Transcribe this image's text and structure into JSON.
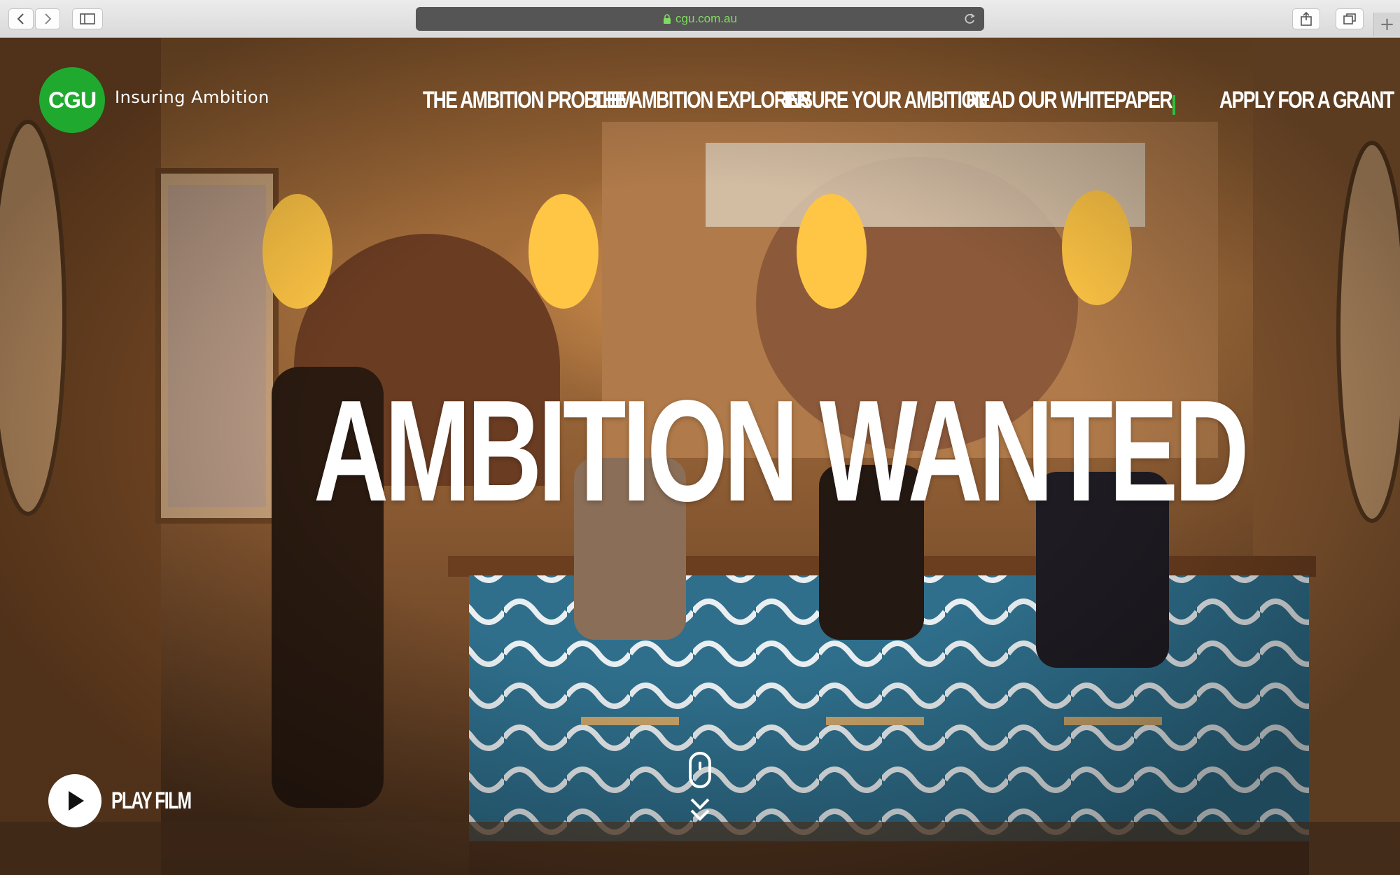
{
  "browser": {
    "url": "cgu.com.au",
    "icons": {
      "back": "chevron-left-icon",
      "forward": "chevron-right-icon",
      "sidebar": "sidebar-icon",
      "lock": "lock-icon",
      "reload": "reload-icon",
      "share": "share-icon",
      "tabs": "tabs-icon",
      "new_tab": "plus-icon"
    },
    "new_tab_label": "+"
  },
  "site": {
    "logo_text": "CGU",
    "tagline": "Insuring Ambition",
    "brand_color": "#1faa2f",
    "nav": [
      {
        "label": "THE AMBITION PROBLEM"
      },
      {
        "label": "THE AMBITION EXPLORER"
      },
      {
        "label": "INSURE YOUR AMBITION"
      },
      {
        "label": "READ OUR WHITEPAPER"
      }
    ],
    "cta": "APPLY FOR A GRANT"
  },
  "hero": {
    "headline": "AMBITION WANTED",
    "play_label": "PLAY FILM",
    "icons": {
      "play": "play-icon",
      "scroll": "scroll-mouse-icon",
      "chevrons": "double-chevron-down-icon"
    }
  }
}
